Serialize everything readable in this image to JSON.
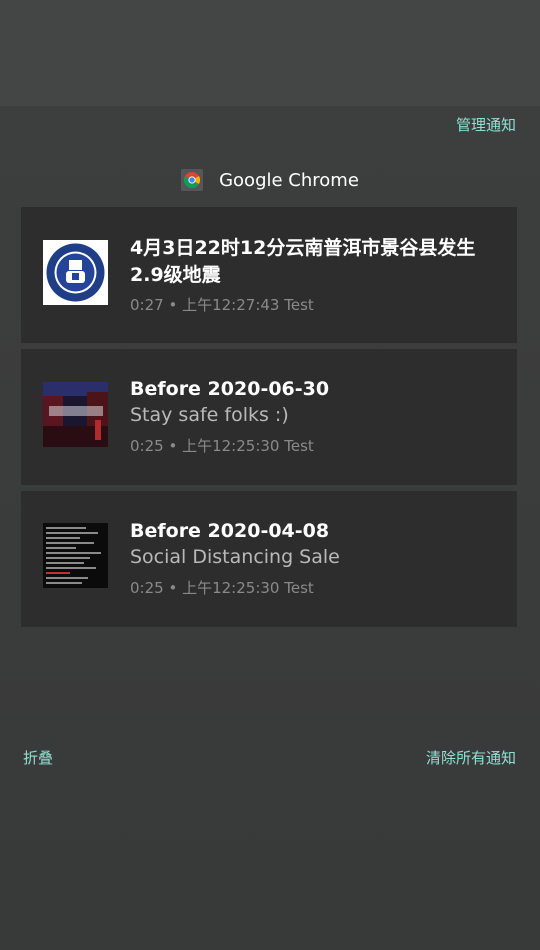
{
  "actions": {
    "manage": "管理通知",
    "collapse": "折叠",
    "clear_all": "清除所有通知"
  },
  "app": {
    "name": "Google Chrome",
    "icon": "chrome-icon"
  },
  "notifications": [
    {
      "title": "4月3日22时12分云南普洱市景谷县发生2.9级地震",
      "body": "",
      "elapsed": "0:27",
      "time": "上午12:27:43",
      "source": "Test",
      "thumb": "seal-thumbnail"
    },
    {
      "title": "Before 2020-06-30",
      "body": "Stay safe folks :)",
      "elapsed": "0:25",
      "time": "上午12:25:30",
      "source": "Test",
      "thumb": "night-scene-thumbnail"
    },
    {
      "title": "Before 2020-04-08",
      "body": "Social Distancing Sale",
      "elapsed": "0:25",
      "time": "上午12:25:30",
      "source": "Test",
      "thumb": "terminal-thumbnail"
    }
  ],
  "colors": {
    "accent": "#8fe0d2",
    "card": "#2d2d2d",
    "panel": "#3b3c3c"
  }
}
